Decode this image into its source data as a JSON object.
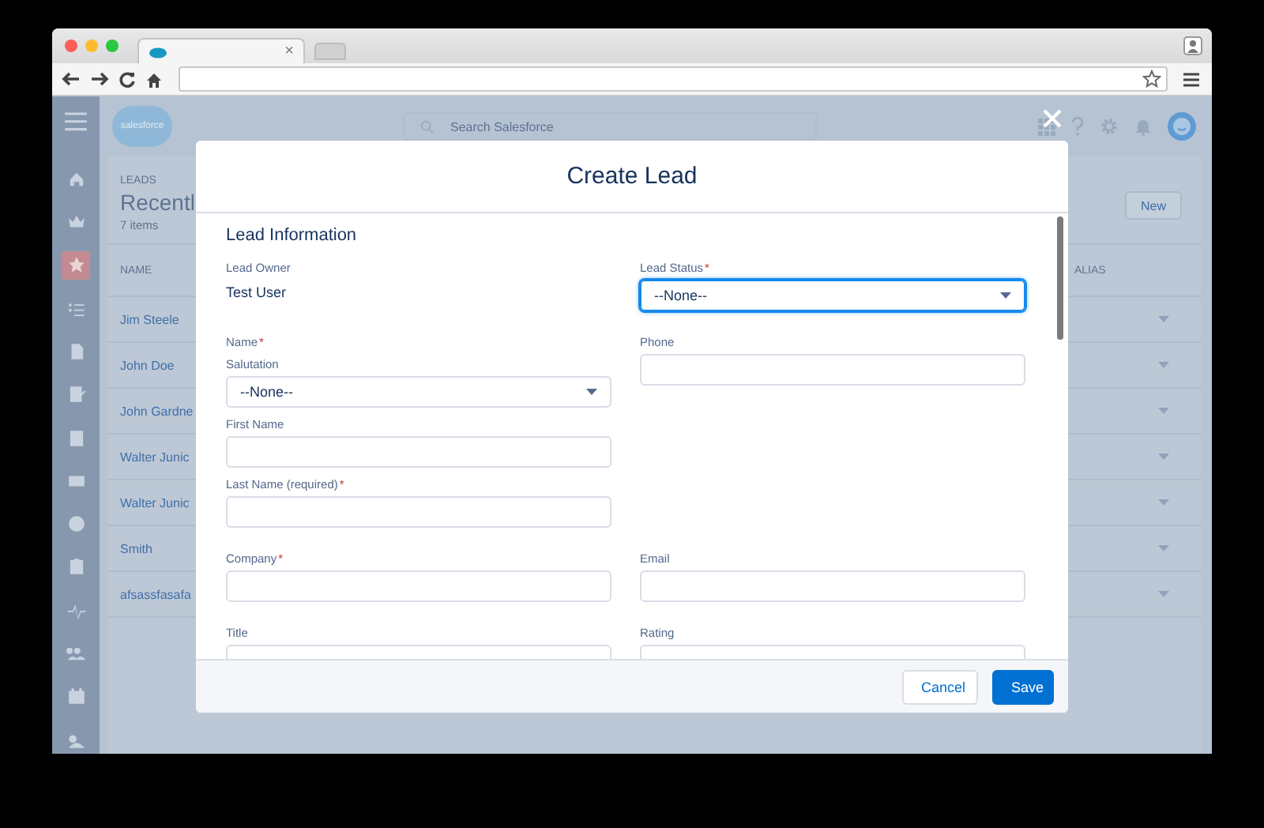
{
  "browser": {
    "tab": {
      "close": "×"
    }
  },
  "app": {
    "logo": "salesforce",
    "search": {
      "placeholder": "Search Salesforce"
    },
    "nav_rail": [
      {
        "selected": false
      },
      {
        "selected": false
      },
      {
        "selected": true
      },
      {
        "selected": false
      },
      {
        "selected": false
      },
      {
        "selected": false
      },
      {
        "selected": false
      },
      {
        "selected": false
      },
      {
        "selected": false
      },
      {
        "selected": false
      },
      {
        "selected": false
      },
      {
        "selected": false
      },
      {
        "selected": false
      },
      {
        "selected": false
      }
    ],
    "list": {
      "object": "LEADS",
      "title": "Recentl",
      "count": "7 items",
      "new_button": "New",
      "columns": [
        "NAME",
        "ALIAS"
      ],
      "rows": [
        {
          "name": "Jim Steele"
        },
        {
          "name": "John Doe"
        },
        {
          "name": "John Gardne"
        },
        {
          "name": "Walter Junic"
        },
        {
          "name": "Walter Junic"
        },
        {
          "name": "Smith"
        },
        {
          "name": "afsassfasafa"
        }
      ]
    }
  },
  "modal": {
    "title": "Create Lead",
    "section": "Lead Information",
    "rows": [
      {
        "left": {
          "kind": "static",
          "label": "Lead Owner",
          "value": "Test User"
        },
        "right": {
          "kind": "select",
          "label": "Lead Status",
          "required_mark": "*",
          "value": "--None--",
          "focused": true
        }
      },
      {
        "left": {
          "kind": "group",
          "label": "Name",
          "required_mark": "*",
          "children": [
            {
              "kind": "select",
              "label": "Salutation",
              "value": "--None--",
              "focused": false
            },
            {
              "kind": "text",
              "label": "First Name"
            },
            {
              "kind": "text",
              "label": "Last Name (required)",
              "required_mark": "*"
            }
          ]
        },
        "right": {
          "kind": "text",
          "label": "Phone"
        }
      },
      {
        "left": {
          "kind": "text",
          "label": "Company",
          "required_mark": "*"
        },
        "right": {
          "kind": "text",
          "label": "Email"
        }
      },
      {
        "left": {
          "kind": "text",
          "label": "Title"
        },
        "right": {
          "kind": "text",
          "label": "Rating"
        }
      }
    ],
    "buttons": [
      {
        "label": "Cancel",
        "kind": "neutral"
      },
      {
        "label": "Save",
        "kind": "brand"
      }
    ]
  }
}
